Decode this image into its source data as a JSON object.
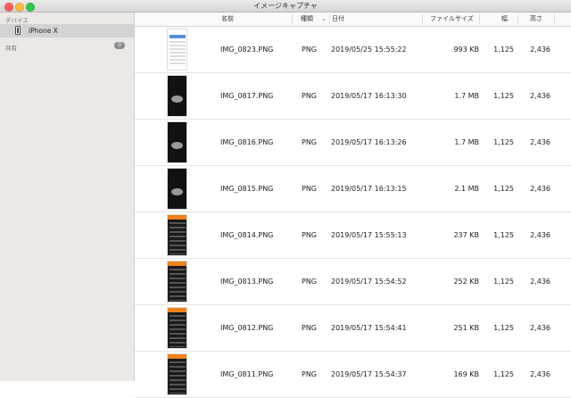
{
  "window": {
    "title": "イメージキャプチャ"
  },
  "sidebar": {
    "devices_header": "デバイス",
    "device_name": "iPhone X",
    "shared_header": "共有",
    "shared_count": "0"
  },
  "columns": {
    "name": "名前",
    "kind": "種類",
    "date": "日付",
    "size": "ファイルサイズ",
    "width": "幅",
    "height": "高さ"
  },
  "files": [
    {
      "name": "IMG_0823.PNG",
      "kind": "PNG",
      "date": "2019/05/25 15:55:22",
      "size": "993 KB",
      "width": "1,125",
      "height": "2,436",
      "thumb": "light"
    },
    {
      "name": "IMG_0817.PNG",
      "kind": "PNG",
      "date": "2019/05/17 16:13:30",
      "size": "1.7 MB",
      "width": "1,125",
      "height": "2,436",
      "thumb": "dark"
    },
    {
      "name": "IMG_0816.PNG",
      "kind": "PNG",
      "date": "2019/05/17 16:13:26",
      "size": "1.7 MB",
      "width": "1,125",
      "height": "2,436",
      "thumb": "dark"
    },
    {
      "name": "IMG_0815.PNG",
      "kind": "PNG",
      "date": "2019/05/17 16:13:15",
      "size": "2.1 MB",
      "width": "1,125",
      "height": "2,436",
      "thumb": "dark"
    },
    {
      "name": "IMG_0814.PNG",
      "kind": "PNG",
      "date": "2019/05/17 15:55:13",
      "size": "237 KB",
      "width": "1,125",
      "height": "2,436",
      "thumb": "orange"
    },
    {
      "name": "IMG_0813.PNG",
      "kind": "PNG",
      "date": "2019/05/17 15:54:52",
      "size": "252 KB",
      "width": "1,125",
      "height": "2,436",
      "thumb": "orange"
    },
    {
      "name": "IMG_0812.PNG",
      "kind": "PNG",
      "date": "2019/05/17 15:54:41",
      "size": "251 KB",
      "width": "1,125",
      "height": "2,436",
      "thumb": "orange"
    },
    {
      "name": "IMG_0811.PNG",
      "kind": "PNG",
      "date": "2019/05/17 15:54:37",
      "size": "169 KB",
      "width": "1,125",
      "height": "2,436",
      "thumb": "orange"
    }
  ]
}
